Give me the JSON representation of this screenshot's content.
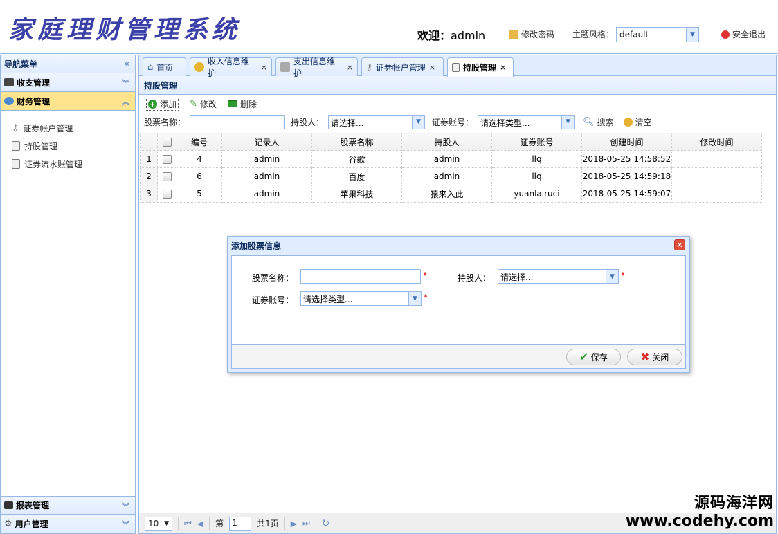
{
  "header": {
    "logo": "家庭理财管理系统",
    "welcome_prefix": "欢迎：",
    "username": "admin",
    "change_password": "修改密码",
    "theme_label": "主题风格：",
    "theme_value": "default",
    "logout": "安全退出"
  },
  "sidebar": {
    "title": "导航菜单",
    "sections": [
      {
        "label": "收支管理"
      },
      {
        "label": "财务管理"
      }
    ],
    "items": [
      {
        "label": "证券帐户管理"
      },
      {
        "label": "持股管理"
      },
      {
        "label": "证券流水账管理"
      }
    ],
    "bottom_sections": [
      {
        "label": "报表管理"
      },
      {
        "label": "用户管理"
      }
    ]
  },
  "tabs": [
    {
      "label": "首页"
    },
    {
      "label": "收入信息维护"
    },
    {
      "label": "支出信息维护"
    },
    {
      "label": "证券帐户管理"
    },
    {
      "label": "持股管理"
    }
  ],
  "content": {
    "title": "持股管理",
    "toolbar": {
      "add": "添加",
      "edit": "修改",
      "delete": "删除"
    },
    "search": {
      "stock_name_label": "股票名称：",
      "holder_label": "持股人：",
      "holder_placeholder": "请选择...",
      "account_label": "证券账号：",
      "account_placeholder": "请选择类型...",
      "search_btn": "搜索",
      "clear_btn": "清空"
    },
    "columns": [
      "编号",
      "记录人",
      "股票名称",
      "持股人",
      "证券账号",
      "创建时间",
      "修改时间"
    ],
    "rows": [
      {
        "rn": "1",
        "id": "4",
        "recorder": "admin",
        "stock": "谷歌",
        "holder": "admin",
        "account": "llq",
        "created": "2018-05-25 14:58:52",
        "modified": ""
      },
      {
        "rn": "2",
        "id": "6",
        "recorder": "admin",
        "stock": "百度",
        "holder": "admin",
        "account": "llq",
        "created": "2018-05-25 14:59:18",
        "modified": ""
      },
      {
        "rn": "3",
        "id": "5",
        "recorder": "admin",
        "stock": "苹果科技",
        "holder": "猿来入此",
        "account": "yuanlairuci",
        "created": "2018-05-25 14:59:07",
        "modified": ""
      }
    ]
  },
  "pager": {
    "page_size": "10",
    "page_prefix": "第",
    "page_value": "1",
    "page_total": "共1页"
  },
  "dialog": {
    "title": "添加股票信息",
    "stock_name_label": "股票名称：",
    "holder_label": "持股人：",
    "holder_placeholder": "请选择...",
    "account_label": "证券账号：",
    "account_placeholder": "请选择类型...",
    "required_mark": "*",
    "save": "保存",
    "close": "关闭"
  },
  "watermark": {
    "line1": "源码海洋网",
    "line2": "www.codehy.com"
  }
}
